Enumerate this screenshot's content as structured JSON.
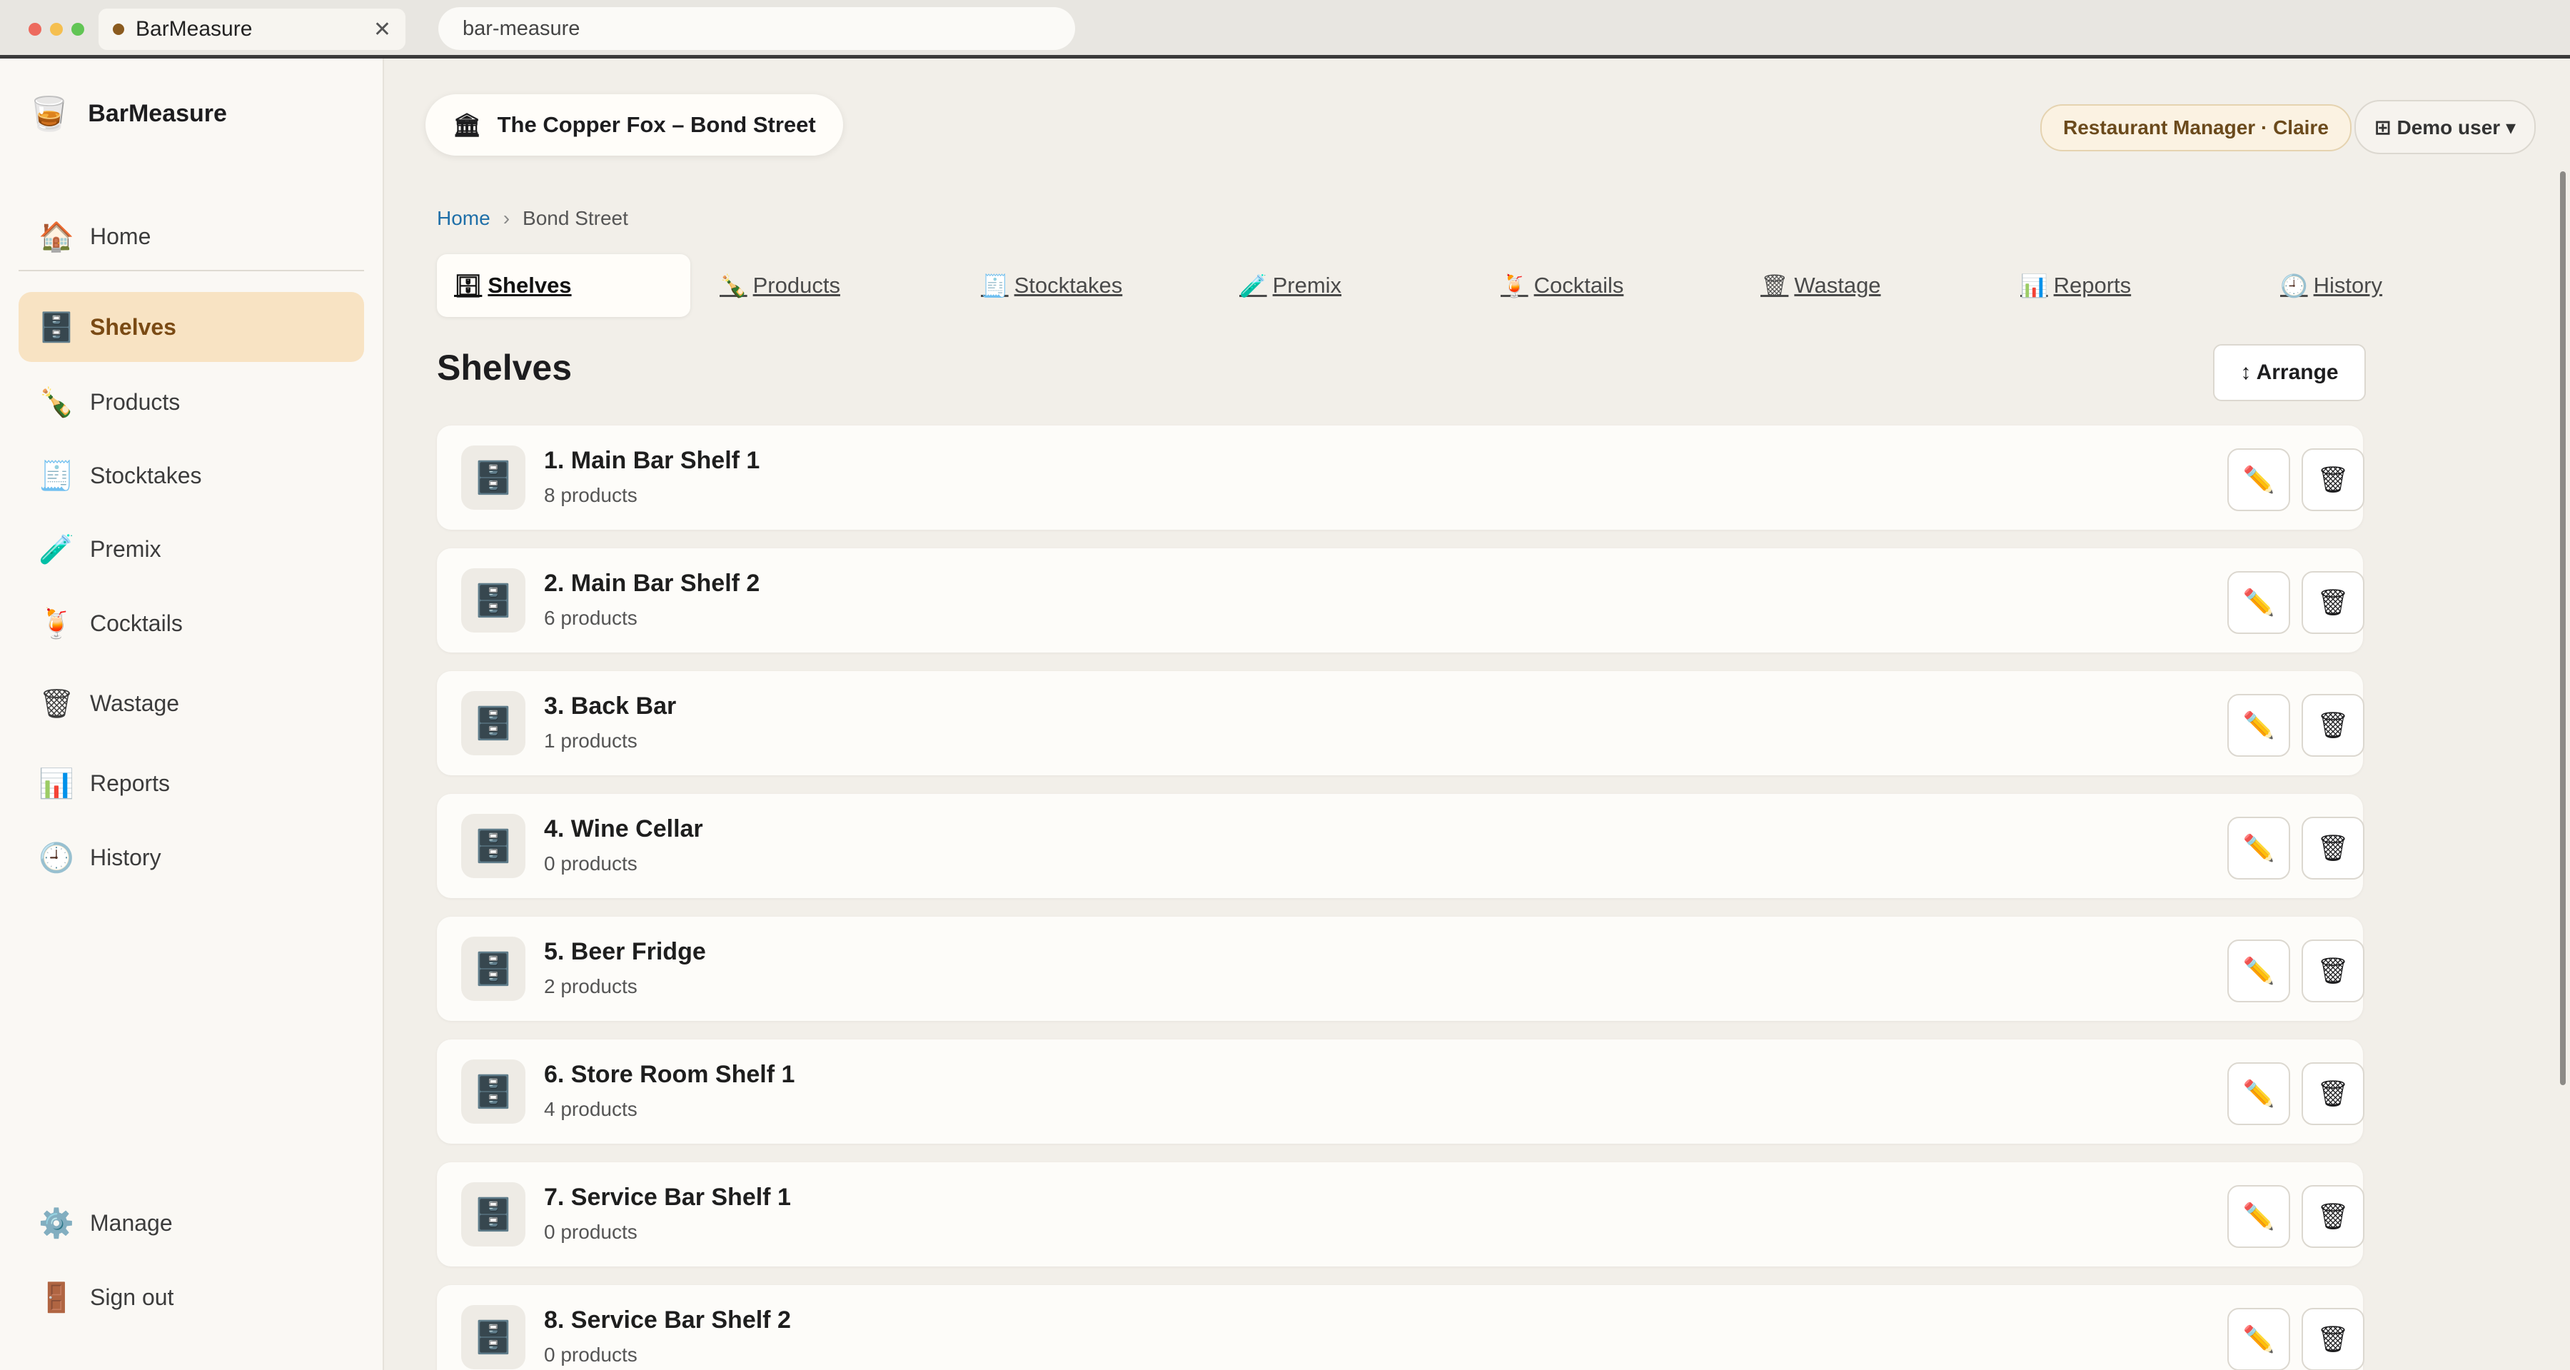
{
  "browser": {
    "tab_title": "BarMeasure",
    "tab_close": "✕",
    "url": "bar-measure",
    "traffic_colors": [
      "#ed6a5e",
      "#f5bf4f",
      "#61c554"
    ]
  },
  "sidebar": {
    "brand": {
      "icon": "🥃",
      "name": "BarMeasure"
    },
    "items": [
      {
        "icon": "🏠",
        "label": "Home"
      },
      {
        "icon": "🗄️",
        "label": "Shelves"
      },
      {
        "icon": "🍾",
        "label": "Products"
      },
      {
        "icon": "🧾",
        "label": "Stocktakes"
      },
      {
        "icon": "🧪",
        "label": "Premix"
      },
      {
        "icon": "🍹",
        "label": "Cocktails"
      },
      {
        "icon": "🗑",
        "label": "Wastage"
      },
      {
        "icon": "📊",
        "label": "Reports"
      },
      {
        "icon": "🕘",
        "label": "History"
      }
    ],
    "footer": [
      {
        "icon": "⚙️",
        "label": "Manage"
      },
      {
        "icon": "🚪",
        "label": "Sign out"
      }
    ]
  },
  "header": {
    "venue_icon": "🏛",
    "venue": "The Copper Fox – Bond Street",
    "role": "Restaurant Manager · Claire",
    "user_icon": "⊞",
    "user": "Demo user ▾"
  },
  "breadcrumb": {
    "home": "Home",
    "separator": "›",
    "current": "Bond Street"
  },
  "tabs": [
    {
      "icon": "🗄",
      "label": "Shelves"
    },
    {
      "icon": "🍾",
      "label": "Products"
    },
    {
      "icon": "🧾",
      "label": "Stocktakes"
    },
    {
      "icon": "🧪",
      "label": "Premix"
    },
    {
      "icon": "🍹",
      "label": "Cocktails"
    },
    {
      "icon": "🗑",
      "label": "Wastage"
    },
    {
      "icon": "📊",
      "label": "Reports"
    },
    {
      "icon": "🕘",
      "label": "History"
    }
  ],
  "section": {
    "title": "Shelves",
    "arrange": "↕ Arrange"
  },
  "shelves": [
    {
      "name": "1. Main Bar Shelf 1",
      "count": "8 products"
    },
    {
      "name": "2. Main Bar Shelf 2",
      "count": "6 products"
    },
    {
      "name": "3. Back Bar",
      "count": "1 products"
    },
    {
      "name": "4. Wine Cellar",
      "count": "0 products"
    },
    {
      "name": "5. Beer Fridge",
      "count": "2 products"
    },
    {
      "name": "6. Store Room Shelf 1",
      "count": "4 products"
    },
    {
      "name": "7. Service Bar Shelf 1",
      "count": "0 products"
    },
    {
      "name": "8. Service Bar Shelf 2",
      "count": "0 products"
    }
  ],
  "icons": {
    "shelf": "🗄️",
    "edit": "✏️",
    "delete": "🗑"
  }
}
